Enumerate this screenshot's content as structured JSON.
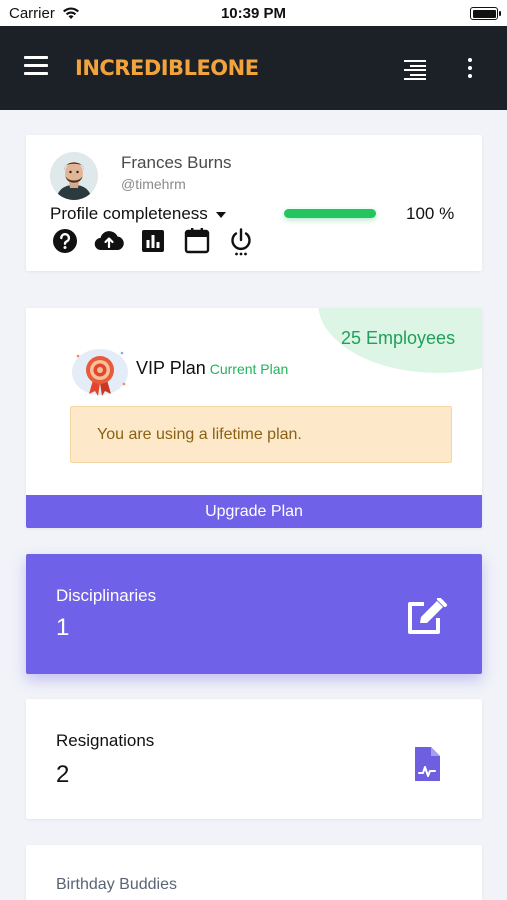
{
  "status_bar": {
    "carrier": "Carrier",
    "time": "10:39 PM"
  },
  "app_bar": {
    "logo_text": "INCREDIBLE",
    "logo_accent": "ONE",
    "menu_icon": "hamburger-icon",
    "align_icon": "align-right-icon",
    "more_icon": "more-vertical-icon",
    "background": "#1c2027",
    "logo_color": "#f2a33c"
  },
  "profile": {
    "name": "Frances Burns",
    "handle": "@timehrm",
    "completeness_label": "Profile completeness",
    "completeness_percent_text": "100 %",
    "completeness_value": 1.0,
    "progress_color": "#22c55e",
    "action_icons": [
      "help-circle-icon",
      "cloud-upload-icon",
      "bar-chart-icon",
      "calendar-icon",
      "power-icon"
    ]
  },
  "plan": {
    "employees": "25 Employees",
    "name": "VIP Plan",
    "status": "Current Plan",
    "notice": "You are using a lifetime plan.",
    "upgrade_label": "Upgrade Plan",
    "accent": "#7062e8"
  },
  "stats": {
    "disciplinaries": {
      "label": "Disciplinaries",
      "value": "1",
      "icon": "edit-icon"
    },
    "resignations": {
      "label": "Resignations",
      "value": "2",
      "icon": "document-icon"
    }
  },
  "birthday": {
    "title": "Birthday Buddies"
  }
}
